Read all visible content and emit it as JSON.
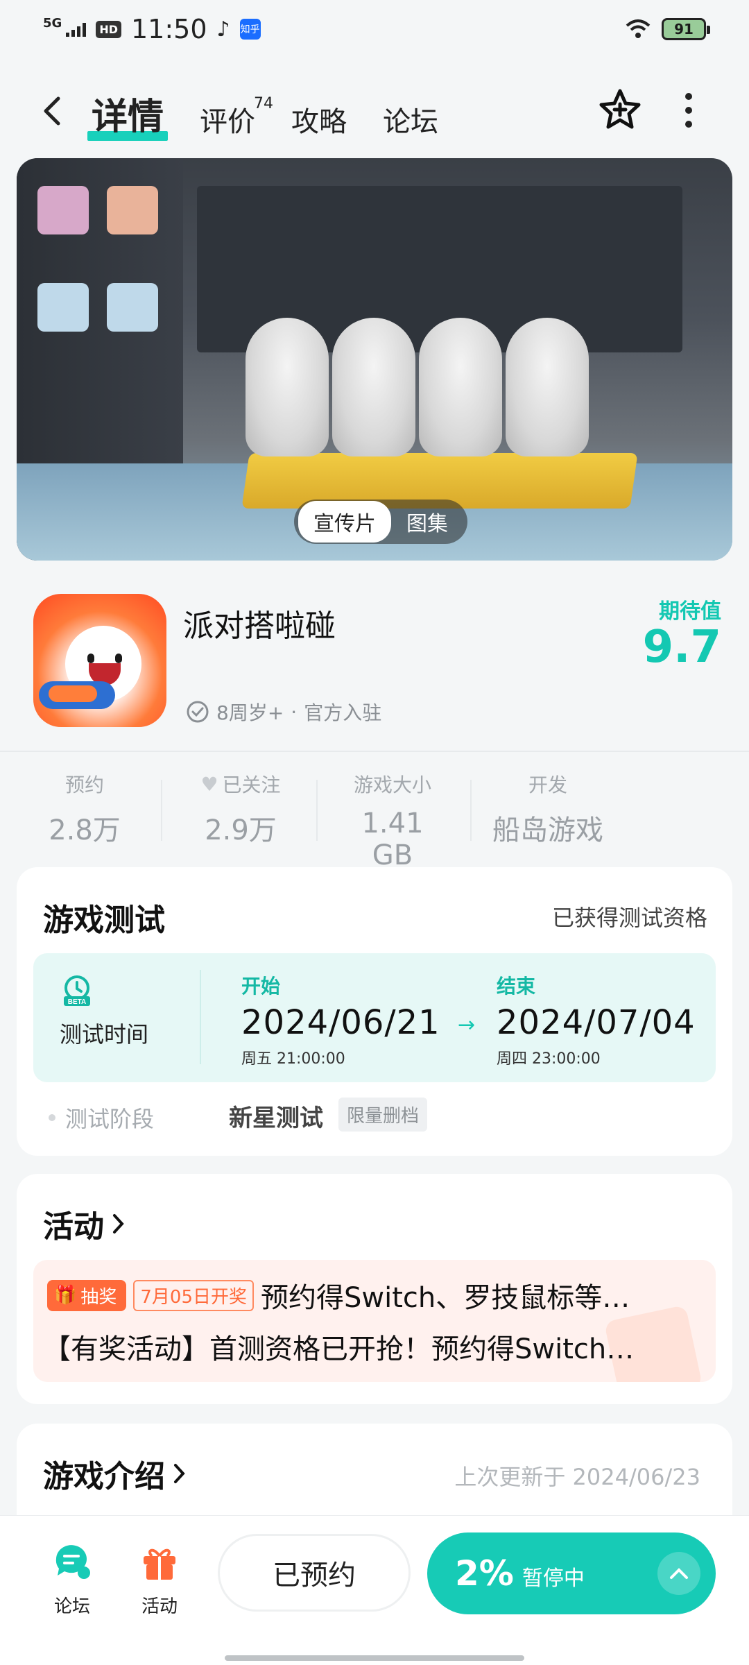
{
  "status_bar": {
    "network": "5G",
    "hd": "HD",
    "time": "11:50",
    "zhihu_label": "知乎",
    "battery": "91"
  },
  "nav": {
    "tabs": [
      {
        "label": "详情",
        "active": true
      },
      {
        "label": "评价",
        "badge": "74"
      },
      {
        "label": "攻略"
      },
      {
        "label": "论坛"
      }
    ],
    "icons": [
      "back-icon",
      "favorite-star-icon",
      "more-vertical-icon"
    ]
  },
  "media": {
    "segments": [
      "宣传片",
      "图集"
    ],
    "active_segment": "宣传片"
  },
  "game": {
    "name": "派对搭啦碰",
    "age": "8周岁+",
    "official": "官方入驻",
    "separator": "·",
    "expect_label": "期待值",
    "expect_score": "9.7"
  },
  "stats": [
    {
      "label": "预约",
      "value": "2.8万"
    },
    {
      "label": "已关注",
      "value": "2.9万",
      "icon": "heart-icon"
    },
    {
      "label": "游戏大小",
      "value": "1.41 GB"
    },
    {
      "label": "开发",
      "value": "船岛游戏"
    }
  ],
  "test": {
    "title": "游戏测试",
    "status": "已获得测试资格",
    "time_label": "测试时间",
    "beta_label": "BETA",
    "start": {
      "head": "开始",
      "date": "2024/06/21",
      "sub": "周五  21:00:00"
    },
    "end": {
      "head": "结束",
      "date": "2024/07/04",
      "sub": "周四  23:00:00"
    },
    "stage_label": "测试阶段",
    "stage_name": "新星测试",
    "stage_tag": "限量删档"
  },
  "activity": {
    "title": "活动",
    "tag": "抽奖",
    "date_tag": "7月05日开奖",
    "line1": "预约得Switch、罗技鼠标等…",
    "line2": "【有奖活动】首测资格已开抢！预约得Switch…"
  },
  "intro": {
    "title": "游戏介绍",
    "updated": "上次更新于 2024/06/23"
  },
  "bottom": {
    "forum": "论坛",
    "activity": "活动",
    "reserved": "已预约",
    "progress_pct": "2%",
    "download_state": "暂停中"
  },
  "colors": {
    "accent": "#17cbb6",
    "promo": "#ff6a3a"
  }
}
